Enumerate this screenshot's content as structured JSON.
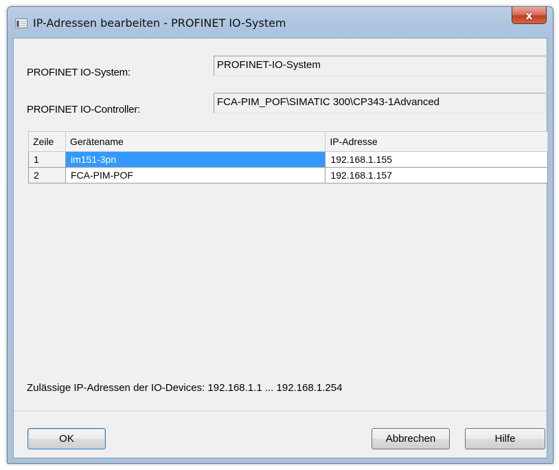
{
  "window": {
    "title": "IP-Adressen bearbeiten - PROFINET IO-System",
    "close_glyph": "x"
  },
  "form": {
    "system_label": "PROFINET IO-System:",
    "system_value": "PROFINET-IO-System",
    "controller_label": "PROFINET IO-Controller:",
    "controller_value": "FCA-PIM_POF\\SIMATIC 300\\CP343-1Advanced"
  },
  "table": {
    "columns": [
      "Zeile",
      "Gerätename",
      "IP-Adresse"
    ],
    "rows": [
      {
        "zeile": "1",
        "geraetename": "im151-3pn",
        "ip": "192.168.1.155",
        "selected": true
      },
      {
        "zeile": "2",
        "geraetename": "FCA-PIM-POF",
        "ip": "192.168.1.157",
        "selected": false
      }
    ]
  },
  "status_text": "Zulässige IP-Adressen der IO-Devices: 192.168.1.1 ... 192.168.1.254",
  "buttons": {
    "ok": "OK",
    "cancel": "Abbrechen",
    "help": "Hilfe"
  },
  "colors": {
    "selection": "#3399ff",
    "titlebar": "#aec6e0",
    "close_button": "#c3401f"
  },
  "icons": {
    "window": "window-icon",
    "close": "close-icon"
  }
}
